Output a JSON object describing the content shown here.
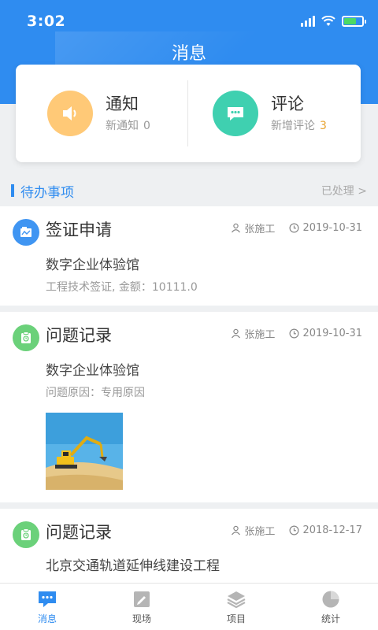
{
  "status_bar": {
    "time": "3:02"
  },
  "header": {
    "title": "消息"
  },
  "summary": {
    "notice": {
      "title": "通知",
      "subtitle": "新通知",
      "count": "0"
    },
    "comment": {
      "title": "评论",
      "subtitle": "新增评论",
      "count": "3"
    }
  },
  "section": {
    "title": "待办事项",
    "link": "已处理 >"
  },
  "tasks": [
    {
      "title": "签证申请",
      "user": "张施工",
      "date": "2019-10-31",
      "project": "数字企业体验馆",
      "detail": "工程技术签证, 金额：10111.0"
    },
    {
      "title": "问题记录",
      "user": "张施工",
      "date": "2019-10-31",
      "project": "数字企业体验馆",
      "detail": "问题原因：专用原因"
    },
    {
      "title": "问题记录",
      "user": "张施工",
      "date": "2018-12-17",
      "project": "北京交通轨道延伸线建设工程"
    }
  ],
  "tabbar": {
    "items": [
      {
        "label": "消息",
        "icon": "message-icon"
      },
      {
        "label": "现场",
        "icon": "site-icon"
      },
      {
        "label": "项目",
        "icon": "layers-icon"
      },
      {
        "label": "统计",
        "icon": "pie-chart-icon"
      }
    ]
  },
  "colors": {
    "primary": "#2f8cf0",
    "notice": "#ffc977",
    "comment": "#3fd0b0",
    "highlight": "#e8a431"
  }
}
